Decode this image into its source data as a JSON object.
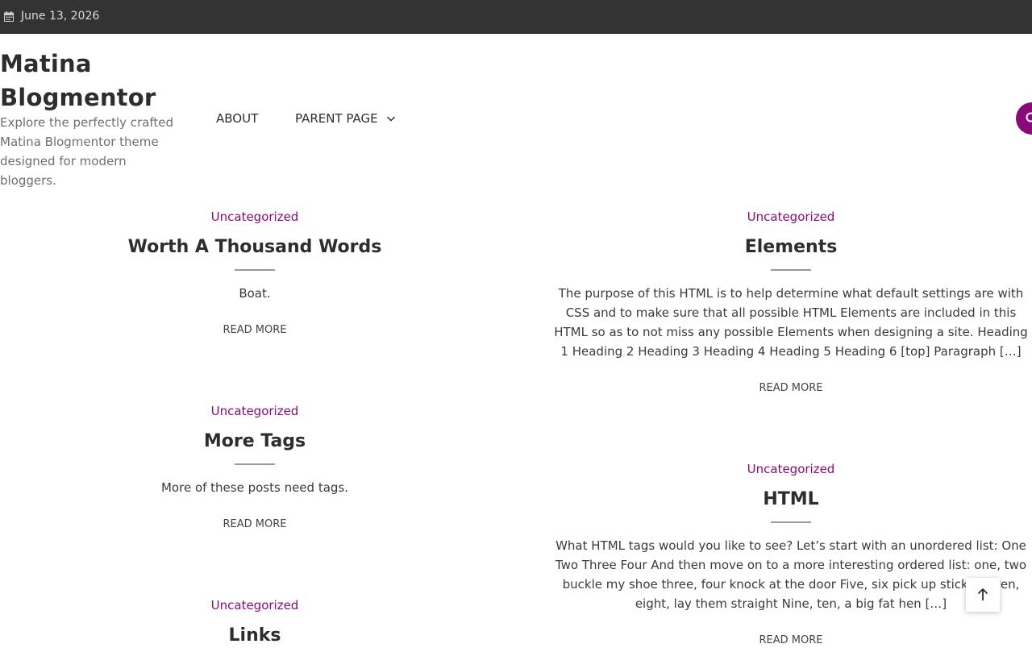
{
  "topbar": {
    "date": "June 13, 2026",
    "date_icon": "calendar-icon"
  },
  "brand": {
    "title": "Matina Blogmentor",
    "tagline": "Explore the perfectly crafted Matina Blogmentor theme designed for modern bloggers."
  },
  "nav": {
    "items": [
      {
        "label": "ABOUT"
      },
      {
        "label": "PARENT PAGE",
        "icon": "chevron-down-icon"
      }
    ],
    "search_icon": "search-icon",
    "accent": "#8a0a7a"
  },
  "posts": [
    {
      "category": "Uncategorized",
      "title": "Worth A Thousand Words",
      "excerpt": "Boat.",
      "more": "READ MORE"
    },
    {
      "category": "Uncategorized",
      "title": "Elements",
      "excerpt": "The purpose of this HTML is to help determine what default settings are with CSS and to make sure that all possible HTML Elements are included in this HTML so as to not miss any possible Elements when designing a site. Heading 1 Heading 2 Heading 3 Heading 4 Heading 5 Heading 6 [top] Paragraph […]",
      "more": "READ MORE"
    },
    {
      "category": "Uncategorized",
      "title": "More Tags",
      "excerpt": "More of these posts need tags.",
      "more": "READ MORE"
    },
    {
      "category": "Uncategorized",
      "title": "HTML",
      "excerpt": "What HTML tags would you like to see? Let’s start with an unordered list: One Two Three Four And then move on to a more interesting ordered list: one, two buckle my shoe three, four knock at the door Five, six pick up sticks Seven, eight, lay them straight Nine, ten, a big fat hen […]",
      "more": "READ MORE"
    },
    {
      "category": "Uncategorized",
      "title": "Links"
    }
  ],
  "scroll_top_icon": "arrow-up-icon"
}
